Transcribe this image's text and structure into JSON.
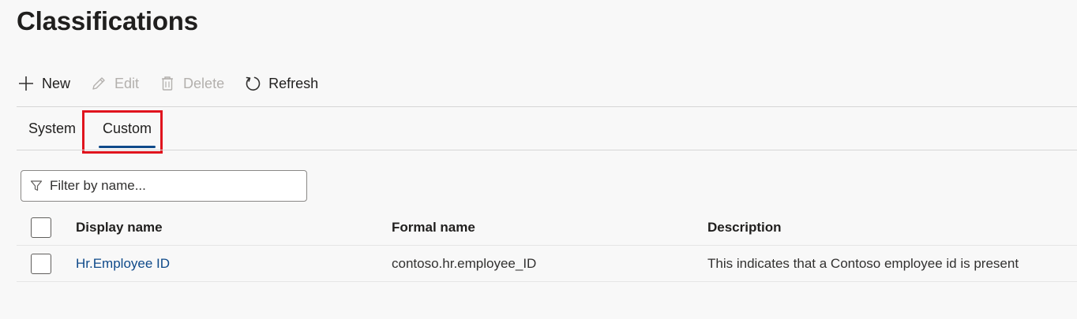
{
  "page": {
    "title": "Classifications"
  },
  "toolbar": {
    "new_label": "New",
    "new_icon": "plus-icon",
    "edit_label": "Edit",
    "edit_icon": "pencil-icon",
    "delete_label": "Delete",
    "delete_icon": "trash-icon",
    "refresh_label": "Refresh",
    "refresh_icon": "refresh-icon"
  },
  "tabs": [
    {
      "label": "System",
      "selected": false
    },
    {
      "label": "Custom",
      "selected": true
    }
  ],
  "filter": {
    "placeholder": "Filter by name...",
    "value": "",
    "icon": "filter-icon"
  },
  "table": {
    "columns": [
      "Display name",
      "Formal name",
      "Description"
    ],
    "rows": [
      {
        "display_name": "Hr.Employee ID",
        "formal_name": "contoso.hr.employee_ID",
        "description": "This indicates that a Contoso employee id is present",
        "selected": false
      }
    ]
  },
  "colors": {
    "accent": "#0f4a8a",
    "highlight": "#e0141e",
    "disabled": "#b3b0ad",
    "background": "#f8f8f8"
  }
}
